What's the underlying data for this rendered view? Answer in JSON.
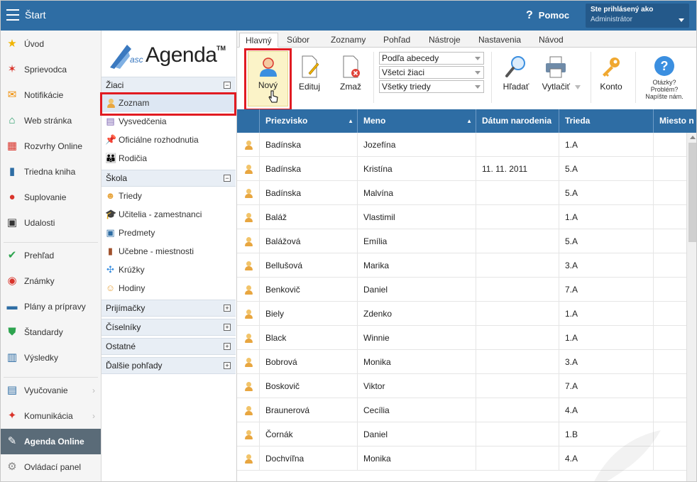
{
  "topbar": {
    "title": "Štart",
    "help_label": "Pomoc",
    "user_line1": "Ste prihlásený ako",
    "user_line2": "Administrátor"
  },
  "leftnav": {
    "items": [
      {
        "label": "Úvod",
        "icon": "star-icon"
      },
      {
        "label": "Sprievodca",
        "icon": "wand-icon"
      },
      {
        "label": "Notifikácie",
        "icon": "envelope-icon"
      },
      {
        "label": "Web stránka",
        "icon": "home-icon"
      },
      {
        "label": "Rozvrhy Online",
        "icon": "calendar-grid-icon"
      },
      {
        "label": "Triedna kniha",
        "icon": "book-icon"
      },
      {
        "label": "Suplovanie",
        "icon": "user-swap-icon"
      },
      {
        "label": "Udalosti",
        "icon": "calendar-icon"
      },
      {
        "label": "Prehľad",
        "icon": "check-circle-icon"
      },
      {
        "label": "Známky",
        "icon": "grade-icon"
      },
      {
        "label": "Plány a prípravy",
        "icon": "briefcase-icon"
      },
      {
        "label": "Štandardy",
        "icon": "shield-check-icon"
      },
      {
        "label": "Výsledky",
        "icon": "bar-chart-icon"
      },
      {
        "label": "Vyučovanie",
        "icon": "open-book-icon"
      },
      {
        "label": "Komunikácia",
        "icon": "chat-icon"
      },
      {
        "label": "Agenda Online",
        "icon": "agenda-logo-icon"
      },
      {
        "label": "Ovládací panel",
        "icon": "gear-icon"
      }
    ]
  },
  "midpanel": {
    "logo_prefix": "asc",
    "logo_name": "Agenda",
    "logo_tm": "TM",
    "sections": {
      "ziaci": "Žiaci",
      "skola": "Škola",
      "prijimacky": "Prijímačky",
      "ciselniky": "Číselníky",
      "ostatne": "Ostatné",
      "dalsie": "Ďalšie pohľady"
    },
    "ziaci_items": [
      "Zoznam",
      "Vysvedčenia",
      "Oficiálne rozhodnutia",
      "Rodičia"
    ],
    "skola_items": [
      "Triedy",
      "Učitelia - zamestnanci",
      "Predmety",
      "Učebne - miestnosti",
      "Krúžky",
      "Hodiny"
    ]
  },
  "ribbon": {
    "tabs": [
      "Hlavný",
      "Súbor",
      "Zoznamy",
      "Pohľad",
      "Nástroje",
      "Nastavenia",
      "Návod"
    ],
    "buttons": {
      "novy": "Nový",
      "edituj": "Edituj",
      "zmaz": "Zmaž",
      "hladat": "Hľadať",
      "vytlacit": "Vytlačiť",
      "konto": "Konto"
    },
    "dropdowns": [
      "Podľa abecedy",
      "Všetci žiaci",
      "Všetky triedy"
    ],
    "faq_lines": [
      "Otázky?",
      "Problém?",
      "Napíšte nám."
    ]
  },
  "table": {
    "headers": [
      "Priezvisko",
      "Meno",
      "Dátum narodenia",
      "Trieda",
      "Miesto n"
    ],
    "rows": [
      [
        "Badínska",
        "Jozefína",
        "",
        "1.A"
      ],
      [
        "Badínska",
        "Kristína",
        "11. 11. 2011",
        "5.A"
      ],
      [
        "Badínska",
        "Malvína",
        "",
        "5.A"
      ],
      [
        "Baláž",
        "Vlastimil",
        "",
        "1.A"
      ],
      [
        "Balážová",
        "Emília",
        "",
        "5.A"
      ],
      [
        "Bellušová",
        "Marika",
        "",
        "3.A"
      ],
      [
        "Benkovič",
        "Daniel",
        "",
        "7.A"
      ],
      [
        "Biely",
        "Zdenko",
        "",
        "1.A"
      ],
      [
        "Black",
        "Winnie",
        "",
        "1.A"
      ],
      [
        "Bobrová",
        "Monika",
        "",
        "3.A"
      ],
      [
        "Boskovič",
        "Viktor",
        "",
        "7.A"
      ],
      [
        "Braunerová",
        "Cecília",
        "",
        "4.A"
      ],
      [
        "Čornák",
        "Daniel",
        "",
        "1.B"
      ],
      [
        "Dochvíľna",
        "Monika",
        "",
        "4.A"
      ]
    ]
  },
  "colors": {
    "brand_blue": "#2e6da4",
    "highlight_red": "#e11b22",
    "nav_active": "#5a6b78"
  }
}
